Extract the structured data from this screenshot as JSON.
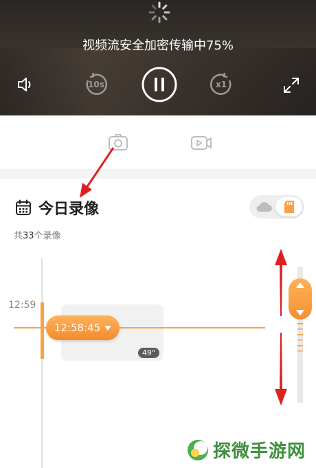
{
  "player": {
    "status_text": "视频流安全加密传输中75%",
    "controls": {
      "volume": "volume-icon",
      "rewind_label": "10s",
      "pause": "pause-icon",
      "speed_label": "x1",
      "fullscreen": "fullscreen-icon"
    }
  },
  "toolbar": {
    "snapshot": "camera-icon",
    "record": "video-record-icon"
  },
  "section": {
    "title": "今日录像",
    "count_prefix": "共",
    "count_value": "33",
    "count_suffix": "个录像"
  },
  "storage_toggle": {
    "options": [
      "cloud-icon",
      "sd-card-icon"
    ],
    "selected": "sd-card-icon"
  },
  "timeline": {
    "hour_label": "12:59",
    "current_time": "12:58:45",
    "recording": {
      "duration": "49\""
    }
  },
  "watermark": {
    "text": "探微手游网"
  },
  "colors": {
    "accent": "#f7a24a",
    "arrow": "#e02020",
    "watermark": "#3d8f3d"
  }
}
